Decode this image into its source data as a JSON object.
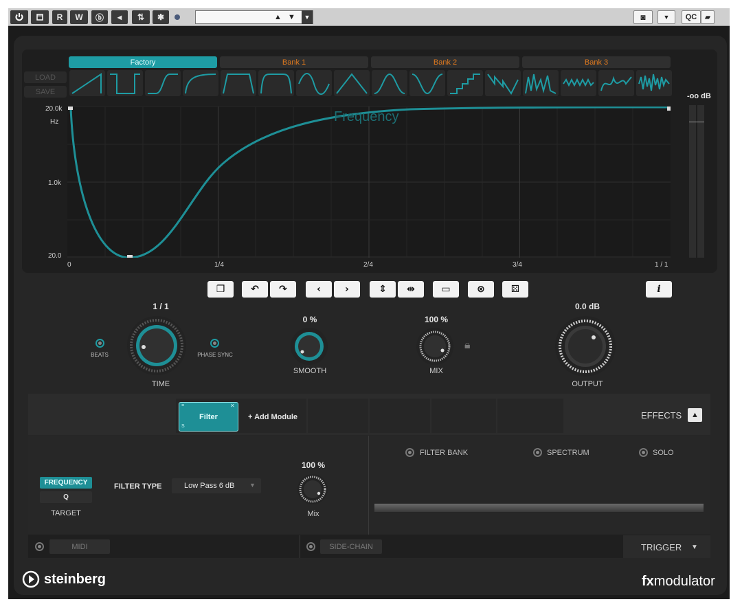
{
  "toolbar": {
    "power_icon": "power-icon",
    "compare_icon": "compare-icon",
    "read_label": "R",
    "write_label": "W",
    "preset_value": "",
    "qc_label": "QC"
  },
  "banks": {
    "tabs": [
      "Factory",
      "Bank 1",
      "Bank 2",
      "Bank 3"
    ],
    "active_index": 0,
    "load_label": "LOAD",
    "save_label": "SAVE",
    "shapes": [
      "ramp-up",
      "square",
      "ramp-curve",
      "exp-curve",
      "trapezoid",
      "soft-trapezoid",
      "sine",
      "triangle",
      "bump",
      "valley",
      "stairs",
      "zigzag",
      "spikes",
      "wave",
      "wobble",
      "noise"
    ]
  },
  "graph": {
    "parameter_label": "Frequency",
    "y_axis": {
      "top": "20.0k",
      "unit": "Hz",
      "mid": "1.0k",
      "bottom": "20.0"
    },
    "x_axis": [
      "0",
      "1/4",
      "2/4",
      "3/4",
      "1 / 1"
    ],
    "meter_label": "-oo dB",
    "accent_color": "#1e9ca4"
  },
  "tools": {
    "info_label": "i"
  },
  "knobs": {
    "time": {
      "value": "1 / 1",
      "label": "TIME",
      "beats_label": "BEATS",
      "phase_sync_label": "PHASE SYNC"
    },
    "smooth": {
      "value": "0 %",
      "label": "SMOOTH"
    },
    "mix": {
      "value": "100 %",
      "label": "MIX"
    },
    "output": {
      "value": "0.0 dB",
      "label": "OUTPUT"
    }
  },
  "modules": {
    "active_module": "Filter",
    "add_module_label": "+ Add Module",
    "effects_label": "EFFECTS"
  },
  "filter": {
    "target_frequency_label": "FREQUENCY",
    "target_q_label": "Q",
    "target_label": "TARGET",
    "filter_type_label": "FILTER TYPE",
    "filter_type_value": "Low Pass 6 dB",
    "mix_value": "100 %",
    "mix_label": "Mix",
    "display_modes": [
      "FILTER BANK",
      "SPECTRUM",
      "SOLO"
    ]
  },
  "footer": {
    "midi_label": "MIDI",
    "sidechain_label": "SIDE-CHAIN",
    "trigger_label": "TRIGGER"
  },
  "branding": {
    "vendor": "steinberg",
    "product_prefix": "fx",
    "product_suffix": "modulator"
  }
}
